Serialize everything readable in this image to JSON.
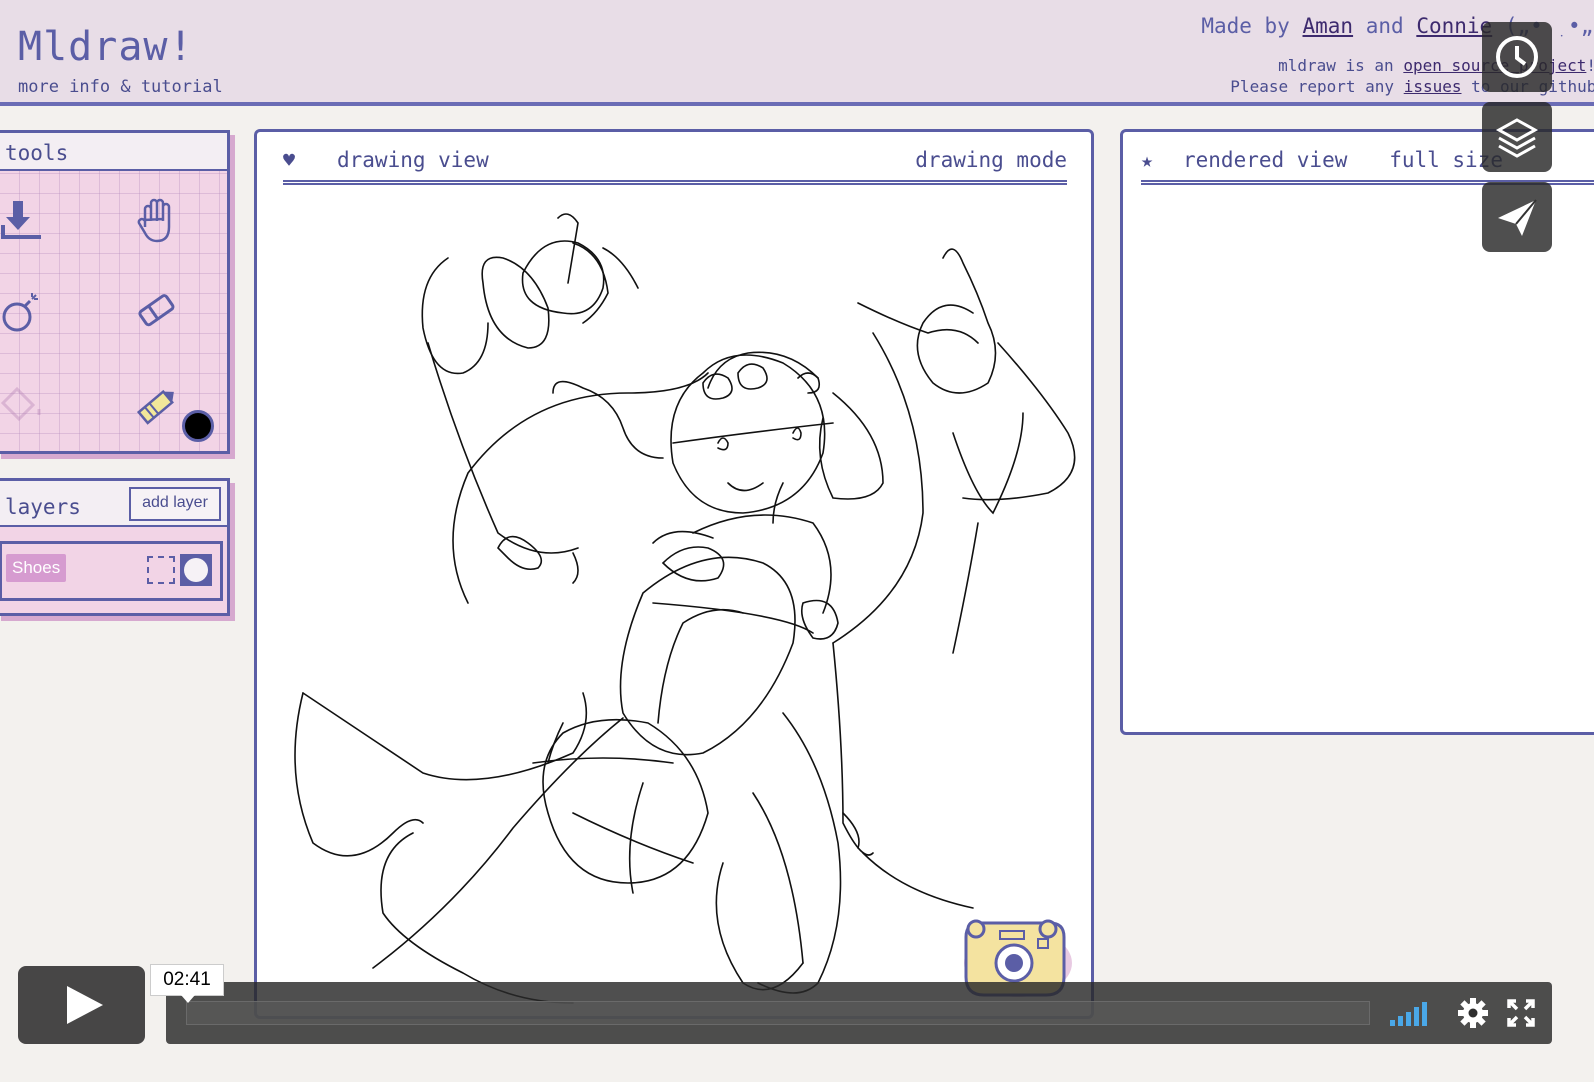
{
  "header": {
    "app_title": "Mldraw!",
    "subtitle_link": "more info & tutorial",
    "credits_prefix": "Made by",
    "author1": "Aman",
    "credits_and": "and",
    "author2": "Connie",
    "credits_suffix": "(„• ִ •„)",
    "info_prefix": "mldraw is an",
    "info_link": "open source project",
    "info_suffix": "!",
    "report_prefix": "Please report any",
    "report_link": "issues",
    "report_suffix": "to our github."
  },
  "tools": {
    "title": "tools",
    "items": [
      "download-icon",
      "hand-icon",
      "bomb-icon",
      "eraser-icon",
      "fill-icon",
      "pencil-icon"
    ],
    "current_color": "#000000"
  },
  "layers": {
    "title": "layers",
    "add_label": "add layer",
    "items": [
      {
        "name": "Shoes"
      }
    ]
  },
  "drawing_view": {
    "icon": "heart-icon",
    "title": "drawing view",
    "mode": "drawing mode"
  },
  "rendered_view": {
    "icon": "star-icon",
    "title": "rendered view",
    "mode": "full size"
  },
  "player": {
    "time": "02:41",
    "side_buttons": [
      "clock-icon",
      "layers-icon",
      "send-icon"
    ],
    "controls": [
      "play-icon",
      "volume-icon",
      "settings-icon",
      "fullscreen-icon"
    ]
  },
  "colors": {
    "accent": "#5b5ea6",
    "header_bg": "#e8dde7",
    "panel_pink": "#f2d4e6",
    "layer_badge": "#d69bd0"
  }
}
